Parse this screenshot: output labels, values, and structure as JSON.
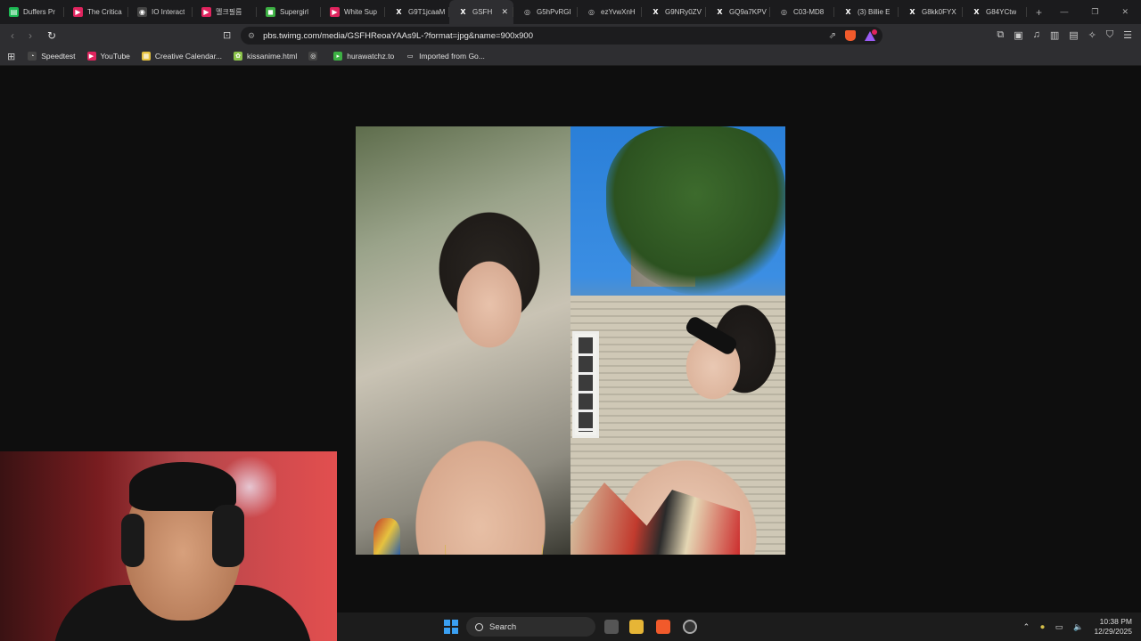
{
  "browser": {
    "tabs": [
      {
        "label": "Duffers Pr",
        "fav_color": "#1db954",
        "fav_glyph": "▤"
      },
      {
        "label": "The Critica",
        "fav_color": "#e0245e",
        "fav_glyph": "▶"
      },
      {
        "label": "IO Interact",
        "fav_color": "#444444",
        "fav_glyph": "◉"
      },
      {
        "label": "멜크필름 ",
        "fav_color": "#e0245e",
        "fav_glyph": "▶"
      },
      {
        "label": "Supergirl",
        "fav_color": "#3cb043",
        "fav_glyph": "◼"
      },
      {
        "label": "White Sup",
        "fav_color": "#e0245e",
        "fav_glyph": "▶"
      },
      {
        "label": "G9T1jcaaM",
        "fav_color": "x",
        "fav_glyph": "X"
      },
      {
        "label": "GSFH",
        "fav_color": "x",
        "fav_glyph": "X",
        "active": true
      },
      {
        "label": "G5hPvRGI",
        "fav_color": "g",
        "fav_glyph": "◎"
      },
      {
        "label": "ezYvwXnH",
        "fav_color": "g",
        "fav_glyph": "◎"
      },
      {
        "label": "G9NRy0ZV",
        "fav_color": "x",
        "fav_glyph": "X"
      },
      {
        "label": "GQ9a7KPV",
        "fav_color": "x",
        "fav_glyph": "X"
      },
      {
        "label": "C03-MD8",
        "fav_color": "g",
        "fav_glyph": "◎"
      },
      {
        "label": "(3) Billie E",
        "fav_color": "x",
        "fav_glyph": "X"
      },
      {
        "label": "G8kk0FYX",
        "fav_color": "x",
        "fav_glyph": "X"
      },
      {
        "label": "G84YCtw",
        "fav_color": "x",
        "fav_glyph": "X"
      }
    ],
    "new_tab": "+",
    "window_controls": [
      "—",
      "❐",
      "✕"
    ],
    "url": "pbs.twimg.com/media/GSFHReoaYAAs9L-?format=jpg&name=900x900",
    "bookmarks": [
      {
        "label": "Speedtest",
        "icon_color": "#444444",
        "glyph": "◔"
      },
      {
        "label": "YouTube",
        "icon_color": "#e0245e",
        "glyph": "▶"
      },
      {
        "label": "Creative Calendar...",
        "icon_color": "#e6c23f",
        "glyph": "▦"
      },
      {
        "label": "kissanime.html",
        "icon_color": "#8bc34a",
        "glyph": "✿"
      },
      {
        "label": "",
        "icon_color": "#444444",
        "glyph": "◎"
      },
      {
        "label": "hurawatchz.to",
        "icon_color": "#3cb043",
        "glyph": "▸"
      },
      {
        "label": "Imported from Go...",
        "icon_color": "#2e2e31",
        "glyph": "▭"
      }
    ]
  },
  "taskbar": {
    "search_label": "Search",
    "time": "10:38 PM",
    "date": "12/29/2025"
  }
}
